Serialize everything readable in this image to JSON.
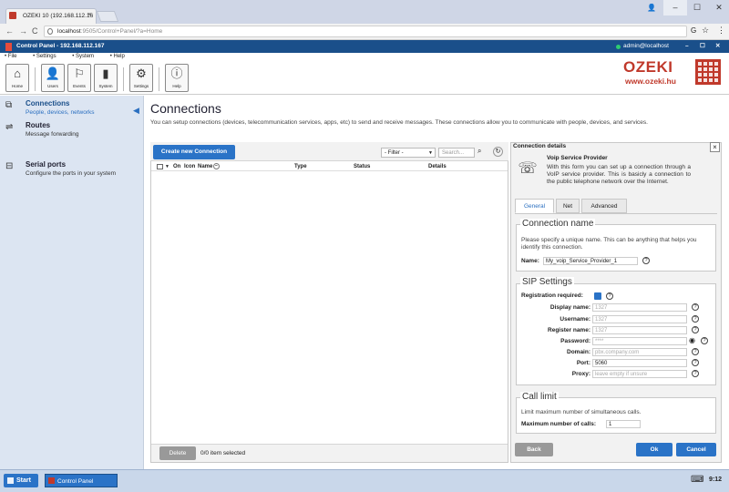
{
  "browser": {
    "tab_title": "OZEKI 10 (192.168.112.16",
    "tab_close": "×",
    "url_host": "localhost",
    "url_rest": ":9505/Control+Panel/?a=Home",
    "win_min": "–",
    "win_max": "☐",
    "win_close": "✕",
    "user_icon": "👤"
  },
  "app": {
    "title": "Control Panel - 192.168.112.167",
    "user": "admin@localhost",
    "menu": [
      "File",
      "Settings",
      "System",
      "Help"
    ],
    "toolbar": [
      {
        "label": "Home",
        "icon": "home-icon",
        "glyph": "⌂"
      },
      {
        "label": "Users",
        "icon": "users-icon",
        "glyph": "👤"
      },
      {
        "label": "Events",
        "icon": "flag-icon",
        "glyph": "⚐"
      },
      {
        "label": "System",
        "icon": "chart-icon",
        "glyph": "▮"
      },
      {
        "label": "Settings",
        "icon": "gear-icon",
        "glyph": "⚙"
      },
      {
        "label": "Help",
        "icon": "info-icon",
        "glyph": "ⓘ"
      }
    ],
    "logo_text": "OZEKI",
    "logo_url": "www.ozeki.hu"
  },
  "sidebar": {
    "items": [
      {
        "title": "Connections",
        "subtitle": "People, devices, networks",
        "icon": "connections-icon"
      },
      {
        "title": "Routes",
        "subtitle": "Message forwarding",
        "icon": "routes-icon"
      },
      {
        "title": "Serial ports",
        "subtitle": "Configure the ports in your system",
        "icon": "serial-port-icon"
      }
    ]
  },
  "main": {
    "heading": "Connections",
    "description": "You can setup connections (devices, telecommunication services, apps, etc) to send and receive messages. These connections allow you to communicate with people, devices, and services.",
    "create_button": "Create new Connection",
    "filter": "- Filter -",
    "search_placeholder": "Search...",
    "columns": [
      "On",
      "Icon",
      "Name",
      "Type",
      "Status",
      "Details"
    ],
    "delete_button": "Delete",
    "selection_info": "0/0 item selected"
  },
  "details": {
    "title": "Connection details",
    "service_name": "Voip Service Provider",
    "service_text": "With this form you can set up a connection through a VoIP service provider. This is basicly a connection to the public telephone network over the Internet.",
    "tabs": [
      "General",
      "Net",
      "Advanced"
    ],
    "conn_name_legend": "Connection name",
    "conn_name_help": "Please specify a unique name. This can be anything that helps you identify this connection.",
    "name_label": "Name:",
    "name_value": "My_voip_Service_Provider_1",
    "sip_legend": "SIP Settings",
    "registration_label": "Registration required:",
    "fields": [
      {
        "label": "Display name:",
        "value": "1327"
      },
      {
        "label": "Username:",
        "value": "1327"
      },
      {
        "label": "Register name:",
        "value": "1327"
      },
      {
        "label": "Password:",
        "value": "****"
      },
      {
        "label": "Domain:",
        "value": "pbx.company.com"
      },
      {
        "label": "Port:",
        "value": "5060"
      },
      {
        "label": "Proxy:",
        "value": "leave empty if unsure"
      }
    ],
    "call_limit_legend": "Call limit",
    "call_limit_help": "Limit maximum number of simultaneous calls.",
    "max_calls_label": "Maximum number of calls:",
    "max_calls_value": "1",
    "back_button": "Back",
    "ok_button": "Ok",
    "cancel_button": "Cancel"
  },
  "taskbar": {
    "start": "Start",
    "task": "Control Panel",
    "clock": "9:12"
  }
}
